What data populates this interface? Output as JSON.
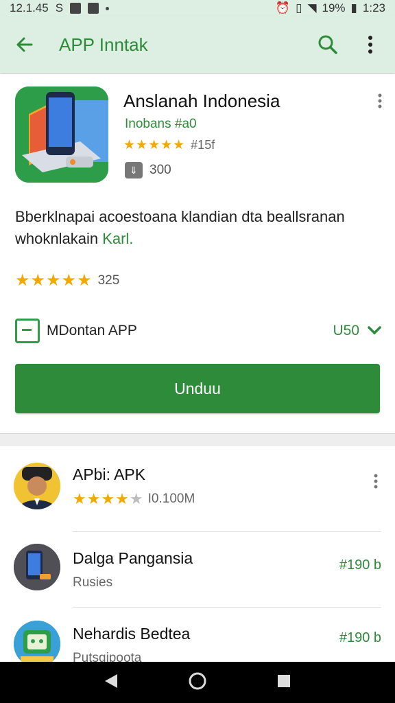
{
  "status_bar": {
    "time_left": "12.1.45",
    "carrier": "S",
    "battery": "19%",
    "clock": "1:23"
  },
  "app_bar": {
    "title": "APP Inntak"
  },
  "app": {
    "name": "Anslanah Indonesia",
    "developer": "Inobans #a0",
    "rating_stars": 5,
    "rating_count": "#15f",
    "downloads": "300",
    "description_main": "Bberklnapai acoestoana klandian dta beallsranan",
    "description_second_plain": "whoknlakain ",
    "description_second_link": "Karl.",
    "review_stars": 5,
    "review_count": "325",
    "contains_label": "MDontan APP",
    "contains_price": "U50",
    "install_label": "Unduu"
  },
  "list": [
    {
      "title": "APbi: APK",
      "stars": 4,
      "subtitle": "I0.100M",
      "price": ""
    },
    {
      "title": "Dalga Pangansia",
      "subtitle": "Rusies",
      "price": "#190 b"
    },
    {
      "title": "Nehardis Bedtea",
      "subtitle": "Putsgipoota",
      "price": "#190 b"
    }
  ],
  "colors": {
    "accent": "#2e8b3a",
    "appbar_bg": "#dcefe2",
    "star": "#f2a900"
  }
}
